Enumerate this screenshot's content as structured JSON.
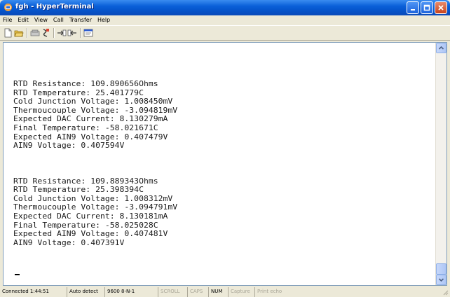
{
  "window": {
    "title": "fgh - HyperTerminal",
    "app_icon": "hyperterminal-icon"
  },
  "menu": [
    "File",
    "Edit",
    "View",
    "Call",
    "Transfer",
    "Help"
  ],
  "toolbar": {
    "icons": [
      "new-icon",
      "open-icon",
      "connect-icon",
      "disconnect-icon",
      "send-icon",
      "receive-icon",
      "properties-icon"
    ]
  },
  "terminal": {
    "lines": [
      "RTD Resistance: 109.890656Ohms",
      "RTD Temperature: 25.401779C",
      "Cold Junction Voltage: 1.008450mV",
      "Thermoucouple Voltage: -3.094819mV",
      "Expected DAC Current: 8.130279mA",
      "Final Temperature: -58.021671C",
      "Expected AIN9 Voltage: 0.407479V",
      "AIN9 Voltage: 0.407594V",
      "",
      "",
      "",
      "RTD Resistance: 109.889343Ohms",
      "RTD Temperature: 25.398394C",
      "Cold Junction Voltage: 1.008312mV",
      "Thermoucouple Voltage: -3.094791mV",
      "Expected DAC Current: 8.130181mA",
      "Final Temperature: -58.025028C",
      "Expected AIN9 Voltage: 0.407481V",
      "AIN9 Voltage: 0.407391V"
    ]
  },
  "status": {
    "connected": "Connected 1:44:51",
    "detect": "Auto detect",
    "settings": "9600 8-N-1",
    "scroll": "SCROLL",
    "caps": "CAPS",
    "num": "NUM",
    "capture": "Capture",
    "print_echo": "Print echo"
  },
  "colors": {
    "title_bar": "#0a5fd8",
    "close_button": "#c8441c",
    "terminal_bg": "#ffffff"
  }
}
